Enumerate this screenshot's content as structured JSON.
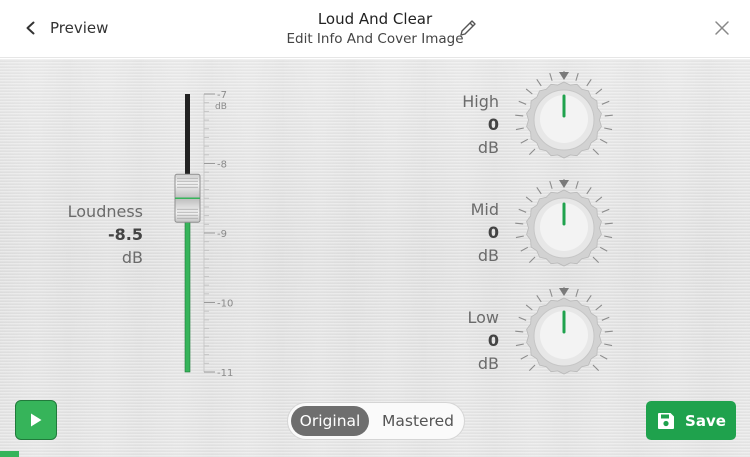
{
  "header": {
    "back_label": "Preview",
    "title": "Loud And Clear",
    "subtitle": "Edit Info And Cover Image"
  },
  "loudness": {
    "label": "Loudness",
    "value": "-8.5",
    "unit": "dB",
    "value_num": -8.5,
    "scale_min": -11,
    "scale_max": -7,
    "scale_labels": [
      "-7",
      "-8",
      "-9",
      "-10",
      "-11"
    ],
    "scale_unit": "dB"
  },
  "eq": {
    "high": {
      "label": "High",
      "value": "0",
      "unit": "dB"
    },
    "mid": {
      "label": "Mid",
      "value": "0",
      "unit": "dB"
    },
    "low": {
      "label": "Low",
      "value": "0",
      "unit": "dB"
    }
  },
  "toggle": {
    "original": "Original",
    "mastered": "Mastered",
    "selected": "Original"
  },
  "save_label": "Save",
  "playback_progress": 0.025,
  "colors": {
    "accent": "#1fa24d",
    "slider_green": "#36b45a",
    "dark": "#222222"
  }
}
